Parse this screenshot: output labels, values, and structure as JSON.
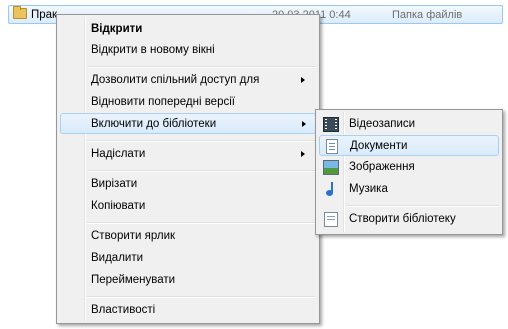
{
  "file_row": {
    "name": "Прак",
    "date": "20.03.2011 0:44",
    "type": "Папка файлів"
  },
  "context_menu": {
    "open": "Відкрити",
    "open_new_window": "Відкрити в новому вікні",
    "share_with": "Дозволити спільний доступ для",
    "restore_versions": "Відновити попередні версії",
    "include_in_library": "Включити до бібліотеки",
    "send_to": "Надіслати",
    "cut": "Вирізати",
    "copy": "Копіювати",
    "create_shortcut": "Створити ярлик",
    "delete": "Видалити",
    "rename": "Перейменувати",
    "properties": "Властивості"
  },
  "library_submenu": {
    "videos": "Відеозаписи",
    "documents": "Документи",
    "pictures": "Зображення",
    "music": "Музика",
    "create_library": "Створити бібліотеку"
  },
  "icons": {
    "folder": "folder-icon",
    "videos": "video-library-icon",
    "documents": "document-library-icon",
    "pictures": "picture-library-icon",
    "music": "music-library-icon",
    "create_library": "new-library-icon"
  },
  "colors": {
    "menu_background": "#f0f0f0",
    "menu_border": "#979797",
    "highlight_background": "#d9ebfb",
    "highlight_border": "#a8d1f5",
    "secondary_text": "#6d6d6d"
  }
}
